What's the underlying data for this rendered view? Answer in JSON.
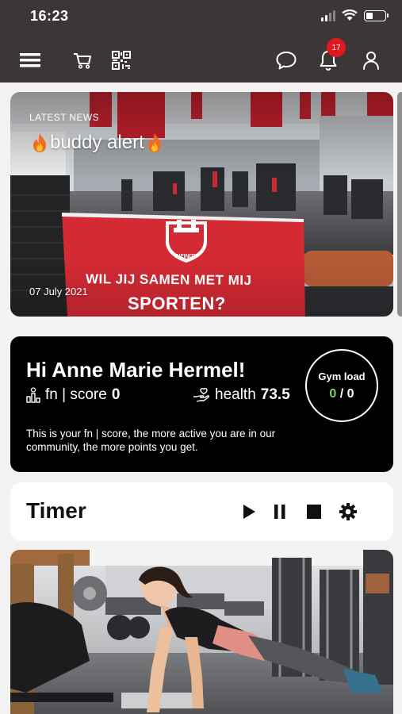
{
  "status_bar": {
    "time": "16:23"
  },
  "header": {
    "notification_count": "17"
  },
  "news": {
    "tag": "LATEST NEWS",
    "title": "buddy alert",
    "date": "07 July 2021",
    "banner_line1": "WIL JIJ SAMEN MET MIJ",
    "banner_line2": "SPORTEN?",
    "logo_text": "INFINITY"
  },
  "score_card": {
    "greeting": "Hi Anne Marie Hermel!",
    "fn_label": "fn | score",
    "fn_value": "0",
    "health_label": "health",
    "health_value": "73.5",
    "description": "This is your fn | score, the more active you are in our community, the more points you get.",
    "gym_load_label": "Gym load",
    "gym_load_current": "0",
    "gym_load_separator": " / ",
    "gym_load_max": "0"
  },
  "timer": {
    "title": "Timer"
  },
  "colors": {
    "header_bg": "#3c3636",
    "badge": "#e0191f",
    "gym_load_accent": "#7ed36b",
    "banner_red": "#d32a34"
  },
  "icons": [
    "menu-icon",
    "cart-icon",
    "qr-code-icon",
    "chat-icon",
    "bell-icon",
    "user-icon",
    "fire-icon",
    "play-icon",
    "pause-icon",
    "stop-icon",
    "gear-icon"
  ]
}
